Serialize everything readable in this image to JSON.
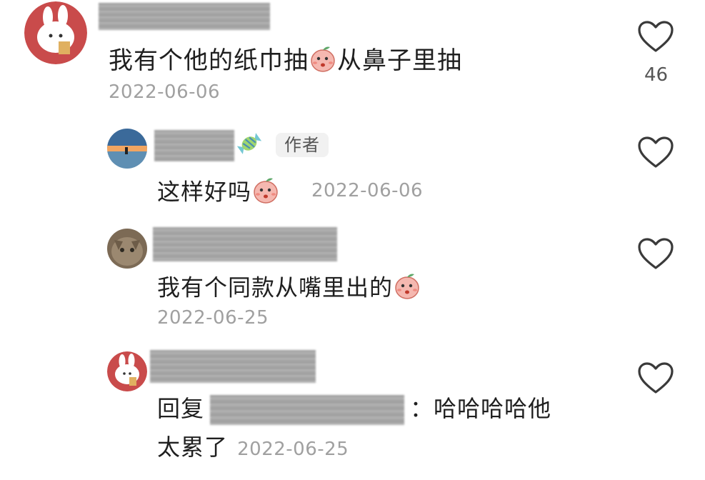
{
  "comments": [
    {
      "text_before_emoji": "我有个他的纸巾抽",
      "text_after_emoji": "从鼻子里抽",
      "date": "2022-06-06",
      "like_count": "46"
    }
  ],
  "replies": [
    {
      "badge": "作者",
      "text": "这样好吗",
      "date": "2022-06-06"
    },
    {
      "text": "我有个同款从嘴里出的",
      "date": "2022-06-25"
    },
    {
      "reply_prefix": "回复",
      "reply_sep": "：",
      "text_line1": "哈哈哈哈他",
      "text_line2": "太累了",
      "date": "2022-06-25"
    }
  ],
  "icons": {
    "like": "heart-outline-icon",
    "emoji": "peach-face-emoji",
    "candy": "candy-icon"
  },
  "colors": {
    "text": "#1f1f1f",
    "date": "#a0a0a0",
    "badge_bg": "#f1f1f1"
  }
}
